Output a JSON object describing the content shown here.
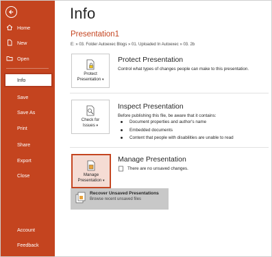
{
  "sidebar": {
    "top_items": [
      {
        "label": "Home",
        "icon": "home-icon"
      },
      {
        "label": "New",
        "icon": "new-document-icon"
      },
      {
        "label": "Open",
        "icon": "folder-open-icon"
      }
    ],
    "selected": "Info",
    "items": [
      "Save",
      "Save As",
      "Print",
      "Share",
      "Export",
      "Close"
    ],
    "bottom_items": [
      "Account",
      "Feedback"
    ]
  },
  "main": {
    "title": "Info",
    "doc_name": "Presentation1",
    "doc_path": "E: » 03. Folder Autoexec Blogs » 01. Uploaded In Autoexec » 03. 2b",
    "protect": {
      "tile_line1": "Protect",
      "tile_line2": "Presentation",
      "title": "Protect Presentation",
      "desc": "Control what types of changes people can make to this presentation."
    },
    "inspect": {
      "tile_line1": "Check for",
      "tile_line2": "Issues",
      "title": "Inspect Presentation",
      "desc": "Before publishing this file, be aware that it contains:",
      "bullets": [
        "Document properties and author's name",
        "Embedded documents",
        "Content that people with disabilities are unable to read"
      ]
    },
    "manage": {
      "tile_line1": "Manage",
      "tile_line2": "Presentation",
      "title": "Manage Presentation",
      "status": "There are no unsaved changes.",
      "menu_title": "Recover Unsaved Presentations",
      "menu_sub": "Browse recent unsaved files"
    }
  },
  "colors": {
    "sidebar": "#c4441f",
    "accent": "#c4441f",
    "menu_bg": "#c8c8c8"
  }
}
